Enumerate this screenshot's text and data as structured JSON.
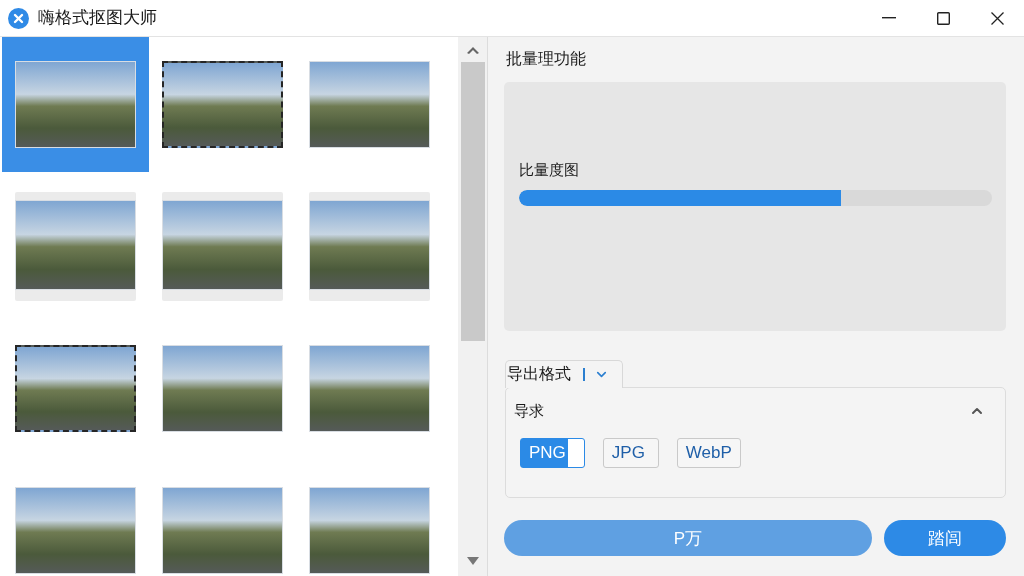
{
  "window": {
    "title": "嗨格式抠图大师"
  },
  "thumbnails": [
    {
      "kind": "plain",
      "selected": true
    },
    {
      "kind": "dashed",
      "selected": false
    },
    {
      "kind": "plain",
      "selected": false
    },
    {
      "kind": "card",
      "selected": false
    },
    {
      "kind": "card",
      "selected": false
    },
    {
      "kind": "card",
      "selected": false
    },
    {
      "kind": "dashed",
      "selected": false
    },
    {
      "kind": "plain",
      "selected": false
    },
    {
      "kind": "plain",
      "selected": false
    },
    {
      "kind": "plain",
      "selected": false
    },
    {
      "kind": "plain",
      "selected": false
    },
    {
      "kind": "plain",
      "selected": false
    }
  ],
  "panel": {
    "title": "批量理功能",
    "progress": {
      "label": "比量度图",
      "level": 0.68
    }
  },
  "export": {
    "tab": {
      "label": "导出格式"
    },
    "section": {
      "title": "导求",
      "expanded": true
    },
    "formats": [
      {
        "label": "PNG",
        "selected": true
      },
      {
        "label": "JPG",
        "selected": false
      },
      {
        "label": "WebP",
        "selected": false
      }
    ]
  },
  "actions": [
    {
      "label": "P万",
      "kind": "secondary"
    },
    {
      "label": "踏闾",
      "kind": "primary"
    }
  ]
}
